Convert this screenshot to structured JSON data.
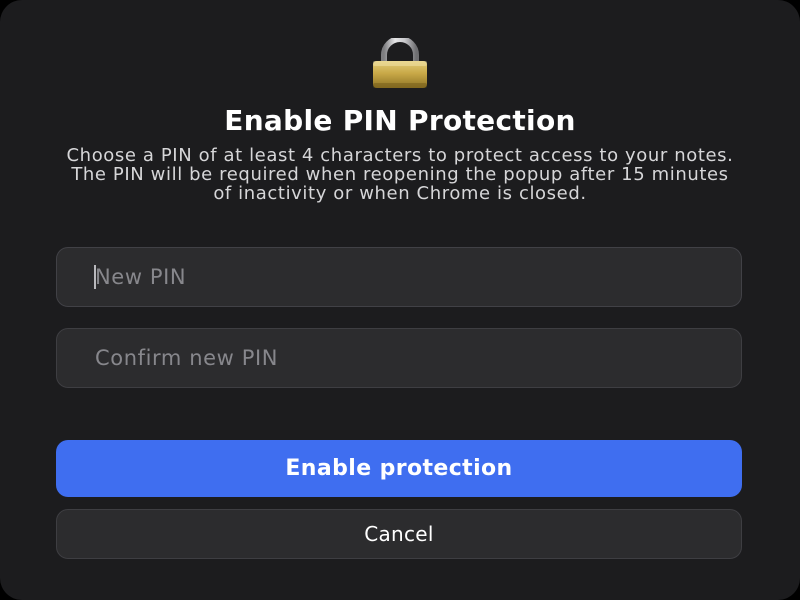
{
  "dialog": {
    "icon": "lock-icon",
    "title": "Enable PIN Protection",
    "description": "Choose a PIN of at least 4 characters to protect access to your notes. The PIN will be required when reopening the popup after 15 minutes of inactivity or when Chrome is closed."
  },
  "fields": {
    "new_pin": {
      "value": "",
      "placeholder": "New PIN"
    },
    "confirm_pin": {
      "value": "",
      "placeholder": "Confirm new PIN"
    }
  },
  "buttons": {
    "enable_label": "Enable protection",
    "cancel_label": "Cancel"
  },
  "colors": {
    "background": "#1c1c1e",
    "field_background": "#2c2c2e",
    "accent": "#3f6ef0",
    "text_primary": "#ffffff",
    "text_secondary": "#d6d6d8",
    "placeholder": "#87878c"
  }
}
